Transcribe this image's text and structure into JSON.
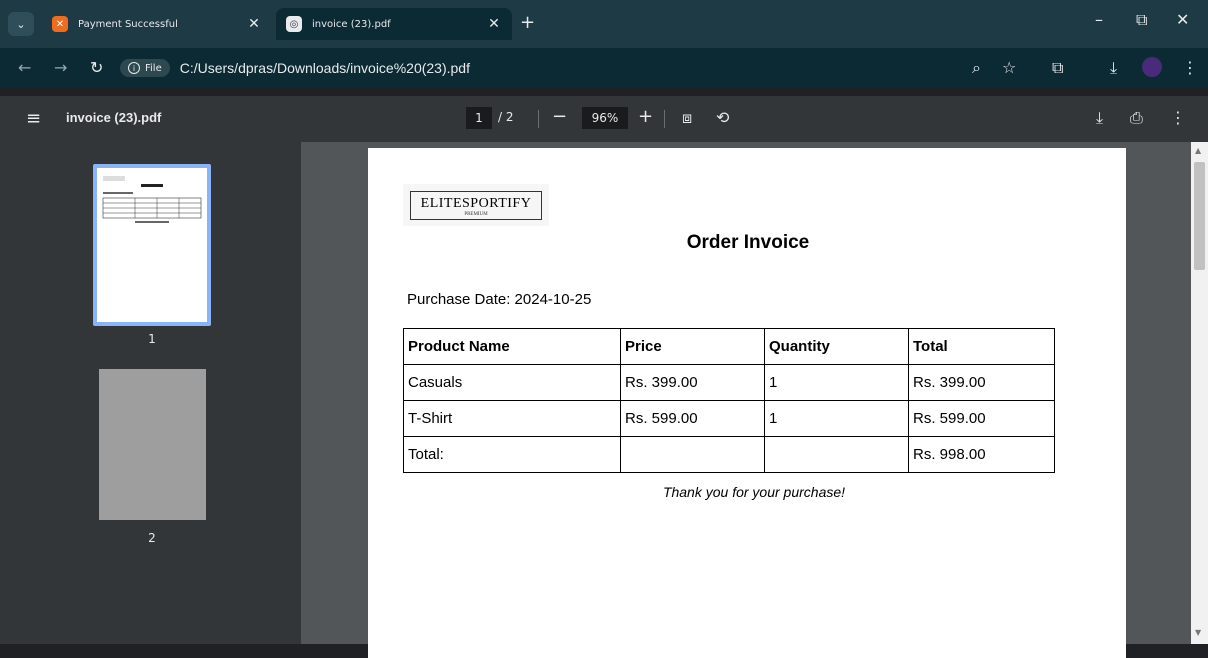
{
  "tabs": [
    {
      "title": "Payment Successful",
      "favicon": "x-app-icon",
      "active": false
    },
    {
      "title": "invoice (23).pdf",
      "favicon": "globe-icon",
      "active": true
    }
  ],
  "toolbar": {
    "chip_label": "File",
    "url": "C:/Users/dpras/Downloads/invoice%20(23).pdf"
  },
  "pdf": {
    "filename": "invoice (23).pdf",
    "current_page": "1",
    "total_pages": "/ 2",
    "zoom": "96%",
    "thumbnails": [
      "1",
      "2"
    ]
  },
  "invoice": {
    "logo_text": "ELITESPORTIFY",
    "logo_sub": "PREMIUM",
    "title": "Order Invoice",
    "purchase_date": "Purchase Date: 2024-10-25",
    "headers": [
      "Product Name",
      "Price",
      "Quantity",
      "Total"
    ],
    "rows": [
      [
        "Casuals",
        "Rs. 399.00",
        "1",
        "Rs. 399.00"
      ],
      [
        "T-Shirt",
        "Rs. 599.00",
        "1",
        "Rs. 599.00"
      ],
      [
        "Total:",
        "",
        "",
        "Rs. 998.00"
      ]
    ],
    "thanks": "Thank you for your purchase!"
  },
  "colors": {
    "accent": "#8ab4f8",
    "tabbar": "#1e3a44",
    "toolbar": "#0b2a33",
    "pdfbar": "#323639"
  }
}
